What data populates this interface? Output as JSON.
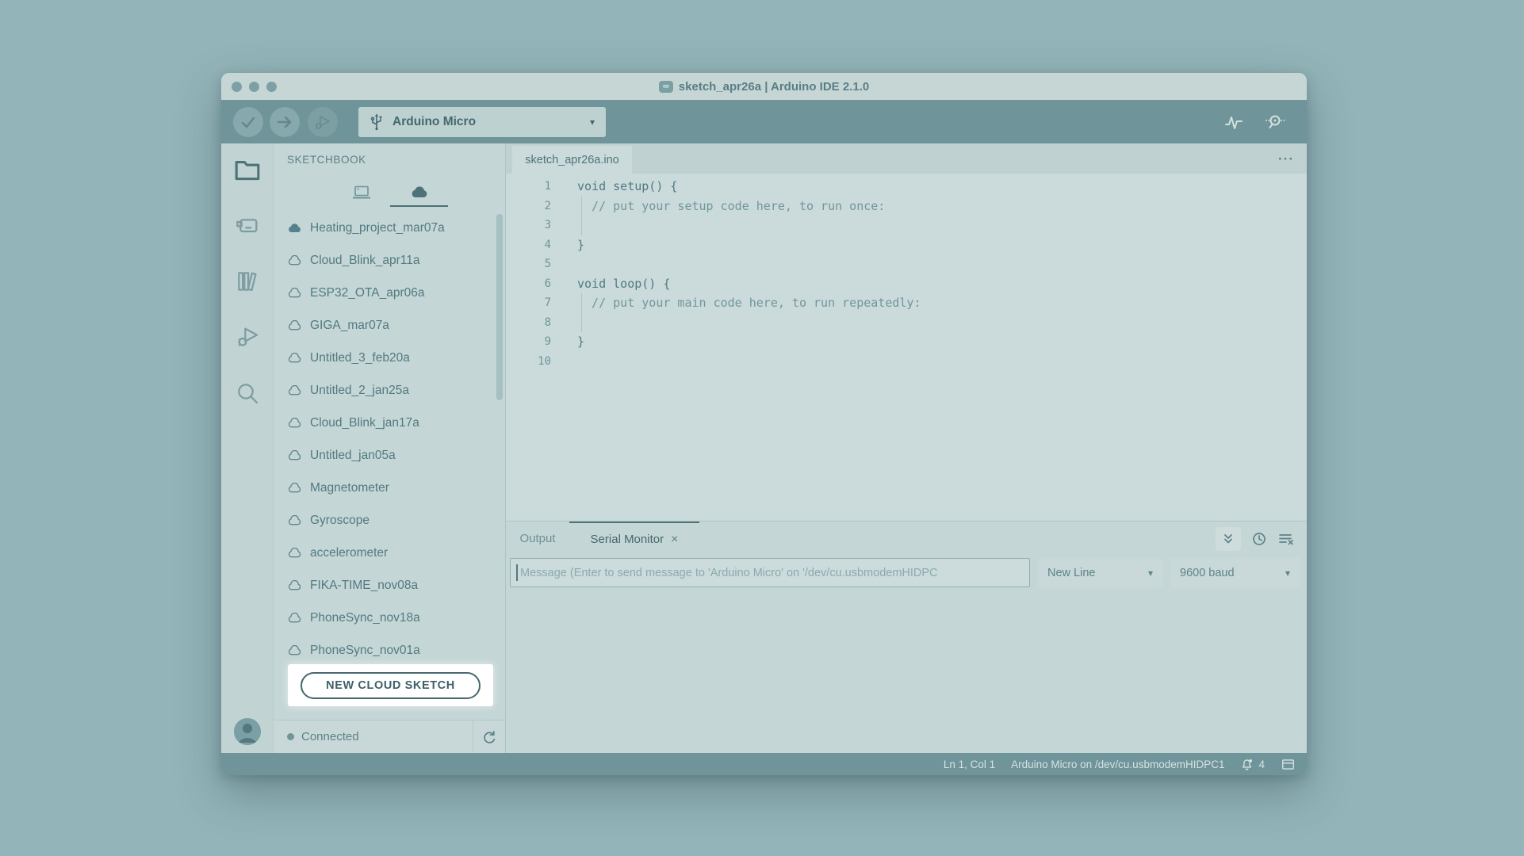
{
  "window_title": "sketch_apr26a | Arduino IDE 2.1.0",
  "app_icon_glyph": "∞",
  "toolbar": {
    "board_name": "Arduino Micro",
    "caret_glyph": "▾"
  },
  "sidebar": {
    "header": "SKETCHBOOK",
    "items": [
      {
        "label": "Heating_project_mar07a",
        "cloud": "filled"
      },
      {
        "label": "Cloud_Blink_apr11a",
        "cloud": "outline"
      },
      {
        "label": "ESP32_OTA_apr06a",
        "cloud": "outline"
      },
      {
        "label": "GIGA_mar07a",
        "cloud": "outline"
      },
      {
        "label": "Untitled_3_feb20a",
        "cloud": "outline"
      },
      {
        "label": "Untitled_2_jan25a",
        "cloud": "outline"
      },
      {
        "label": "Cloud_Blink_jan17a",
        "cloud": "outline"
      },
      {
        "label": "Untitled_jan05a",
        "cloud": "outline"
      },
      {
        "label": "Magnetometer",
        "cloud": "outline"
      },
      {
        "label": "Gyroscope",
        "cloud": "outline"
      },
      {
        "label": "accelerometer",
        "cloud": "outline"
      },
      {
        "label": "FIKA-TIME_nov08a",
        "cloud": "outline"
      },
      {
        "label": "PhoneSync_nov18a",
        "cloud": "outline"
      },
      {
        "label": "PhoneSync_nov01a",
        "cloud": "outline"
      }
    ],
    "new_cloud_sketch_label": "NEW CLOUD SKETCH",
    "connection_status": "Connected"
  },
  "editor": {
    "tab_name": "sketch_apr26a.ino",
    "overflow_menu_glyph": "···",
    "lines": [
      {
        "num": "1",
        "code": "void setup() {"
      },
      {
        "num": "2",
        "code": "  // put your setup code here, to run once:",
        "comment": true,
        "guide": true
      },
      {
        "num": "3",
        "code": "",
        "guide": true
      },
      {
        "num": "4",
        "code": "}"
      },
      {
        "num": "5",
        "code": ""
      },
      {
        "num": "6",
        "code": "void loop() {"
      },
      {
        "num": "7",
        "code": "  // put your main code here, to run repeatedly:",
        "comment": true,
        "guide": true
      },
      {
        "num": "8",
        "code": "",
        "guide": true
      },
      {
        "num": "9",
        "code": "}"
      },
      {
        "num": "10",
        "code": ""
      }
    ]
  },
  "serial_panel": {
    "output_tab": "Output",
    "serial_monitor_tab": "Serial Monitor",
    "close_glyph": "×",
    "message_placeholder": "Message (Enter to send message to 'Arduino Micro' on '/dev/cu.usbmodemHIDPC",
    "line_ending": "New Line",
    "baud_rate": "9600 baud",
    "caret_glyph": "▾"
  },
  "status_bar": {
    "cursor_position": "Ln 1, Col 1",
    "board_connection": "Arduino Micro on /dev/cu.usbmodemHIDPC1",
    "notification_count": "4"
  },
  "colors": {
    "page_background": "#93b4b8",
    "toolbar_dark": "#6f9499",
    "panel_light": "#c5d6d6",
    "editor_background": "#cbdada",
    "accent_dark_teal": "#4d7278",
    "highlight_white": "#ffffff",
    "text_primary": "#4f767d"
  }
}
